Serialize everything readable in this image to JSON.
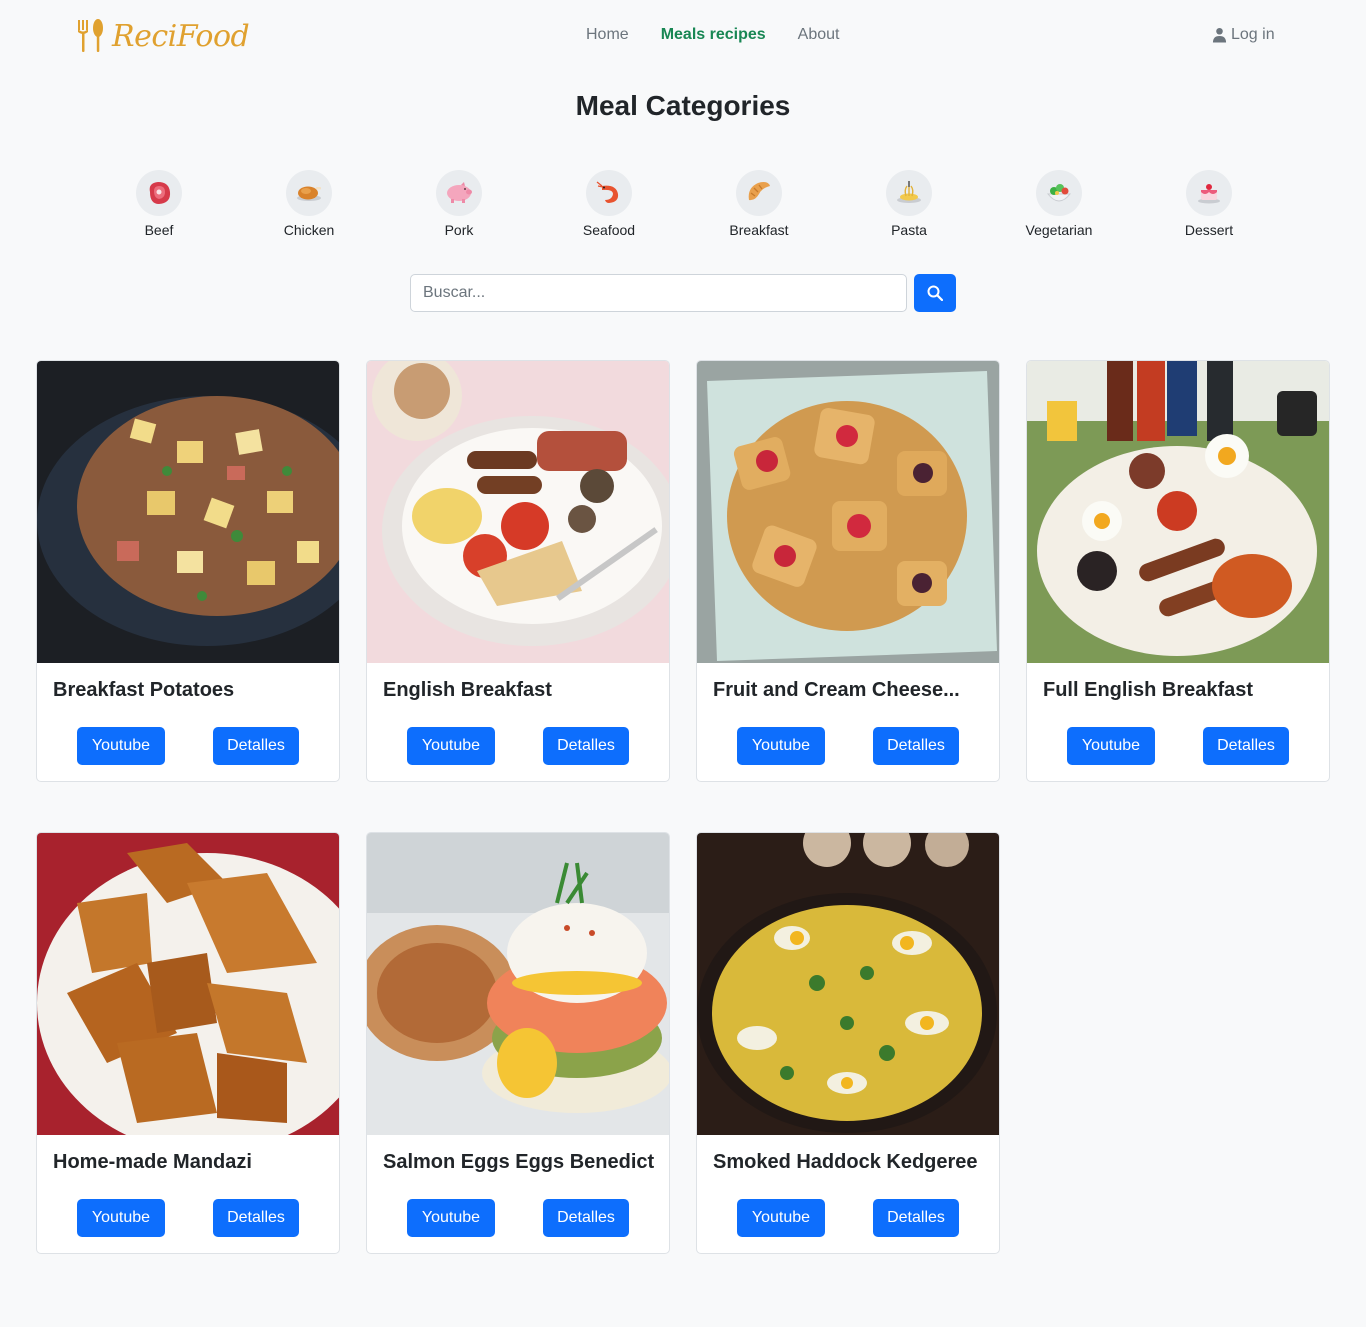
{
  "brand": {
    "name": "ReciFood",
    "icon": "fork-spoon-icon",
    "color": "#e0a12f"
  },
  "nav": {
    "links": [
      {
        "label": "Home",
        "active": false
      },
      {
        "label": "Meals recipes",
        "active": true
      },
      {
        "label": "About",
        "active": false
      }
    ],
    "login_label": "Log in",
    "login_icon": "user-icon"
  },
  "page_title": "Meal Categories",
  "categories": [
    {
      "label": "Beef",
      "icon": "meat-icon"
    },
    {
      "label": "Chicken",
      "icon": "roast-chicken-icon"
    },
    {
      "label": "Pork",
      "icon": "pig-icon"
    },
    {
      "label": "Seafood",
      "icon": "shrimp-icon"
    },
    {
      "label": "Breakfast",
      "icon": "croissant-icon"
    },
    {
      "label": "Pasta",
      "icon": "spaghetti-icon"
    },
    {
      "label": "Vegetarian",
      "icon": "salad-icon"
    },
    {
      "label": "Dessert",
      "icon": "cake-icon"
    }
  ],
  "search": {
    "placeholder": "Buscar...",
    "value": "",
    "button_icon": "search-icon"
  },
  "buttons": {
    "youtube": "Youtube",
    "details": "Detalles"
  },
  "meals": [
    {
      "title": "Breakfast Potatoes"
    },
    {
      "title": "English Breakfast"
    },
    {
      "title": "Fruit and Cream Cheese..."
    },
    {
      "title": "Full English Breakfast"
    },
    {
      "title": "Home-made Mandazi"
    },
    {
      "title": "Salmon Eggs Eggs Benedict"
    },
    {
      "title": "Smoked Haddock Kedgeree"
    }
  ],
  "colors": {
    "primary": "#0d6efd",
    "active_nav": "#198754",
    "muted": "#6c757d",
    "background": "#f8f9fa"
  }
}
